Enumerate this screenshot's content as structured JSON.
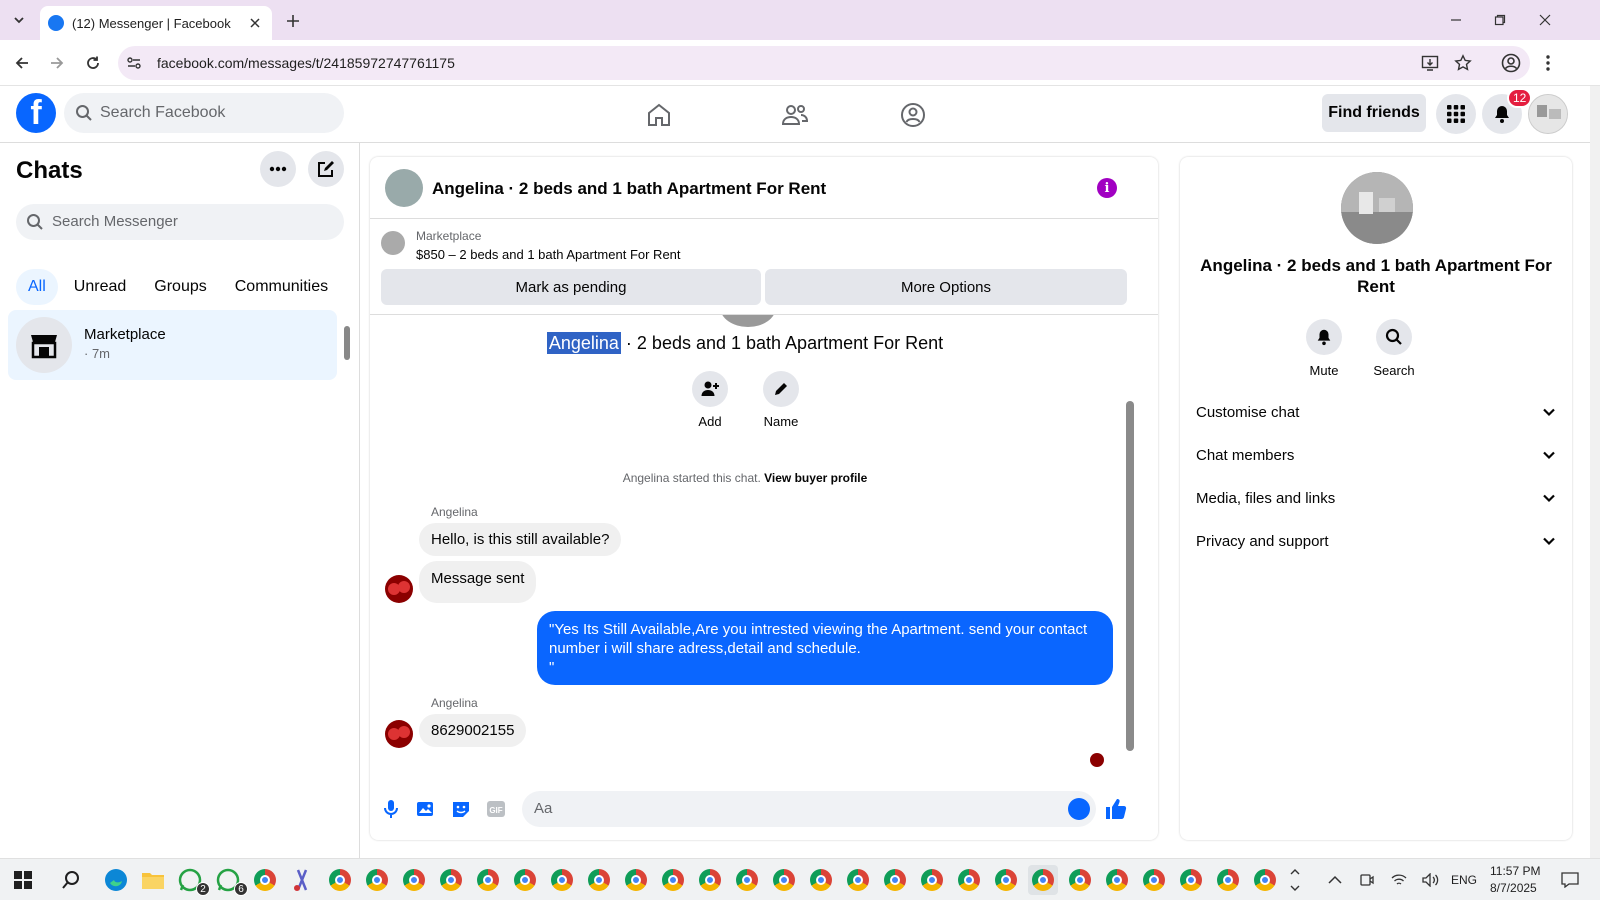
{
  "browser": {
    "tab_title": "(12) Messenger | Facebook",
    "url": "facebook.com/messages/t/24185972747761175"
  },
  "facebook": {
    "search_placeholder": "Search Facebook",
    "find_friends": "Find friends",
    "notification_count": "12"
  },
  "sidebar": {
    "title": "Chats",
    "search_placeholder": "Search Messenger",
    "filters": [
      "All",
      "Unread",
      "Groups",
      "Communities"
    ],
    "active_filter": "All",
    "chats": [
      {
        "name": "Marketplace",
        "time": "· 7m"
      }
    ]
  },
  "chat": {
    "title": "Angelina · 2 beds and 1 bath Apartment For Rent",
    "marketplace_label": "Marketplace",
    "listing": "$850 – 2 beds and 1 bath Apartment For Rent",
    "mark_pending": "Mark as pending",
    "more_options": "More Options",
    "header_name_highlight": "Angelina",
    "header_name_rest": " · 2 beds and 1 bath Apartment For Rent",
    "actions": [
      "Add",
      "Name"
    ],
    "started_text": "Angelina started this chat.",
    "view_profile": "View buyer profile",
    "messages": [
      {
        "sender": "Angelina",
        "text": "Hello, is this still available?"
      },
      {
        "text": "Message sent"
      },
      {
        "outgoing": true,
        "text": "\"Yes Its Still Available,Are you intrested viewing the Apartment. send your contact number i will share adress,detail and schedule.\n\""
      },
      {
        "sender": "Angelina",
        "text": "8629002155"
      }
    ],
    "composer_placeholder": "Aa",
    "composer_gif": "GIF"
  },
  "info_panel": {
    "name": "Angelina · 2 beds and 1 bath Apartment For Rent",
    "actions": [
      "Mute",
      "Search"
    ],
    "sections": [
      "Customise chat",
      "Chat members",
      "Media, files and links",
      "Privacy and support"
    ]
  },
  "taskbar": {
    "lang": "ENG",
    "time": "11:57 PM",
    "date": "8/7/2025",
    "badge_whatsapp1": "2",
    "badge_whatsapp2": "6"
  },
  "colors": {
    "accent": "#0866ff",
    "outgoing_bubble": "#0a66ff",
    "info_icon": "#a100c2",
    "badge": "#e41e3f"
  }
}
